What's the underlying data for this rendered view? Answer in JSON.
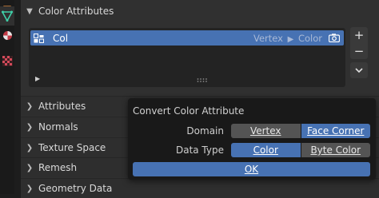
{
  "color_attributes_panel": {
    "title": "Color Attributes",
    "list": {
      "items": [
        {
          "name": "Col",
          "domain": "Vertex",
          "data_type": "Color",
          "selected": true
        }
      ]
    },
    "add_icon": "plus-icon",
    "remove_icon": "minus-icon",
    "menu_icon": "chevron-down-icon"
  },
  "sub_panels": [
    "Attributes",
    "Normals",
    "Texture Space",
    "Remesh",
    "Geometry Data"
  ],
  "popup": {
    "title": "Convert Color Attribute",
    "domain_label": "Domain",
    "domain_options": [
      "Vertex",
      "Face Corner"
    ],
    "domain_selected": "Face Corner",
    "data_type_label": "Data Type",
    "data_type_options": [
      "Color",
      "Byte Color"
    ],
    "data_type_selected": "Color",
    "ok_label": "OK"
  },
  "colors": {
    "accent": "#4772b3",
    "panel_bg": "#303030",
    "popup_bg": "#191919"
  }
}
